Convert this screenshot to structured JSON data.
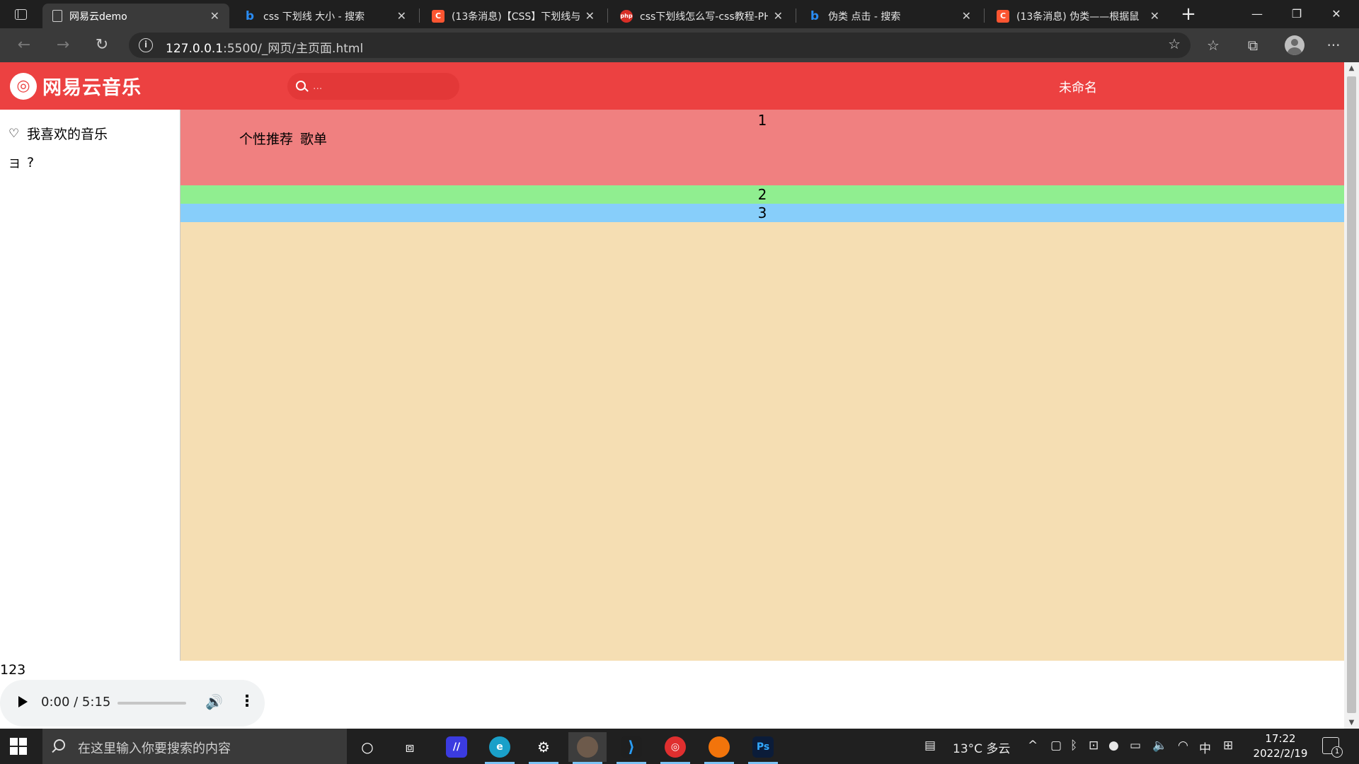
{
  "browser": {
    "tabs": [
      {
        "title": "网易云demo",
        "icon": "page-icon"
      },
      {
        "title": "css 下划线 大小 - 搜索",
        "icon": "bing-icon"
      },
      {
        "title": "(13条消息)【CSS】下划线与",
        "icon": "csdn-icon"
      },
      {
        "title": "css下划线怎么写-css教程-PH",
        "icon": "php-icon"
      },
      {
        "title": "伪类 点击 - 搜索",
        "icon": "bing-icon"
      },
      {
        "title": "(13条消息) 伪类——根据鼠",
        "icon": "csdn-icon"
      }
    ],
    "address": {
      "host": "127.0.0.1",
      "rest": ":5500/_网页/主页面.html"
    }
  },
  "app": {
    "brand": "网易云音乐",
    "search_placeholder": "...",
    "user_name": "未命名",
    "sidebar": [
      {
        "icon": "♡",
        "label": "我喜欢的音乐"
      },
      {
        "icon": "ヨ",
        "label": "?"
      }
    ],
    "block1_number": "1",
    "tabs": [
      "个性推荐",
      "歌单"
    ],
    "block2_number": "2",
    "block3_number": "3",
    "footer_text": "123",
    "audio": {
      "time": "0:00 / 5:15"
    }
  },
  "taskbar": {
    "search_placeholder": "在这里输入你要搜索的内容",
    "weather": "13°C 多云",
    "ime": "中",
    "time": "17:22",
    "date": "2022/2/19",
    "notifications": "1"
  },
  "colors": {
    "brand_red": "#ec4141",
    "block1": "#f08080",
    "block2": "#90ee90",
    "block3": "#87cefa",
    "main_bg": "#f5deb3"
  }
}
